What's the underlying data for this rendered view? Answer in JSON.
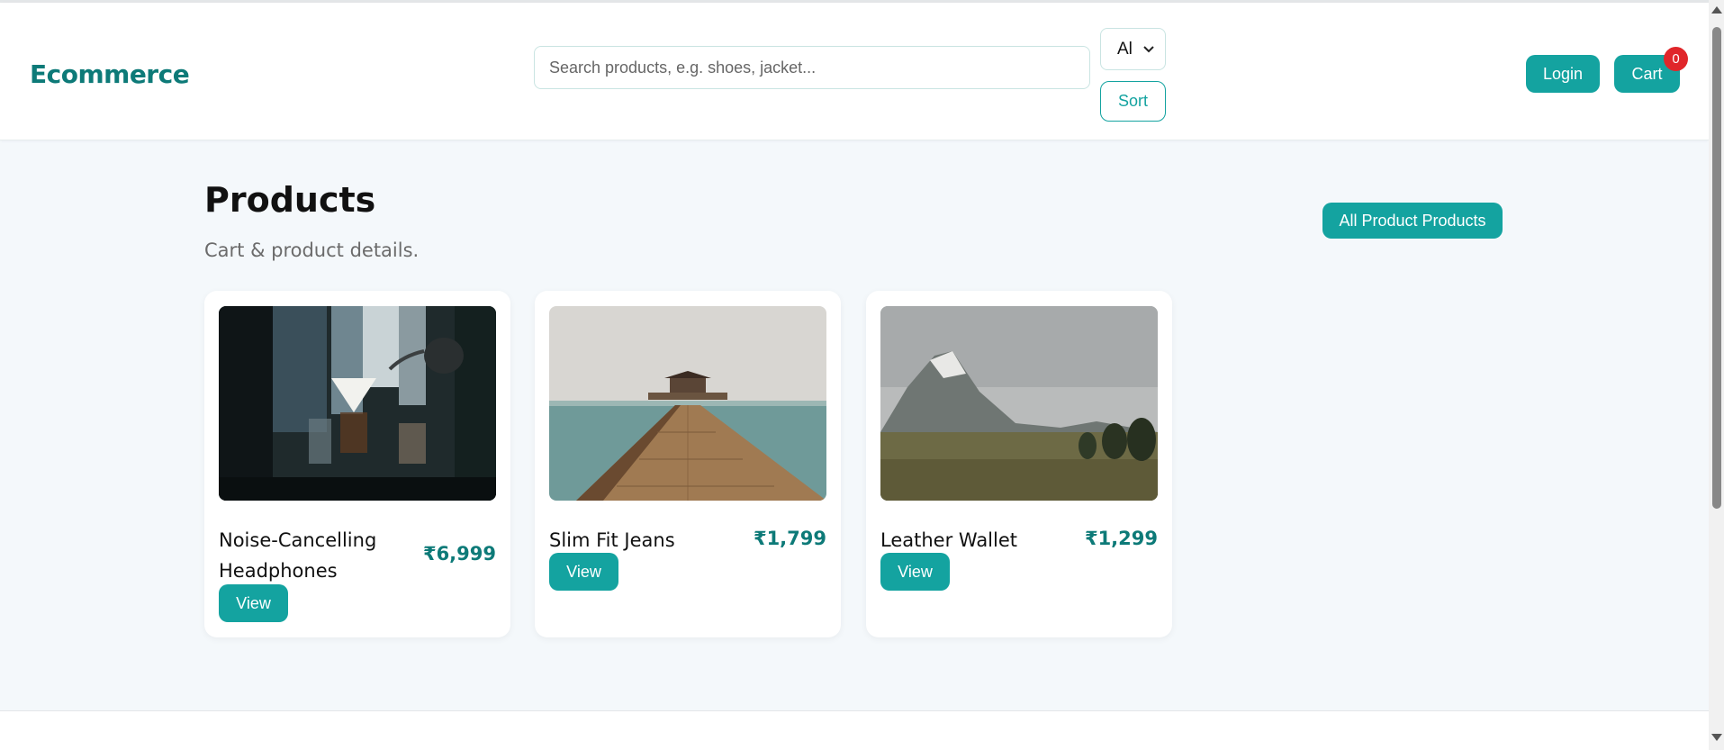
{
  "header": {
    "logo": "Ecommerce",
    "search_placeholder": "Search products, e.g. shoes, jacket...",
    "category_select": "Al",
    "sort_label": "Sort",
    "login_label": "Login",
    "cart_label": "Cart",
    "cart_count": "0"
  },
  "main": {
    "title": "Products",
    "subtitle": "Cart & product details.",
    "all_products_button": "All Product Products"
  },
  "products": [
    {
      "name": "Noise-Cancelling Headphones",
      "price": "₹6,999",
      "view_label": "View",
      "image": "coffee-pour-photo"
    },
    {
      "name": "Slim Fit Jeans",
      "price": "₹1,799",
      "view_label": "View",
      "image": "pier-gazebo-photo"
    },
    {
      "name": "Leather Wallet",
      "price": "₹1,299",
      "view_label": "View",
      "image": "mountain-field-photo"
    }
  ],
  "colors": {
    "accent": "#14a3a0",
    "brand": "#0d7a78",
    "badge": "#e0262a",
    "background": "#f4f8fb"
  }
}
